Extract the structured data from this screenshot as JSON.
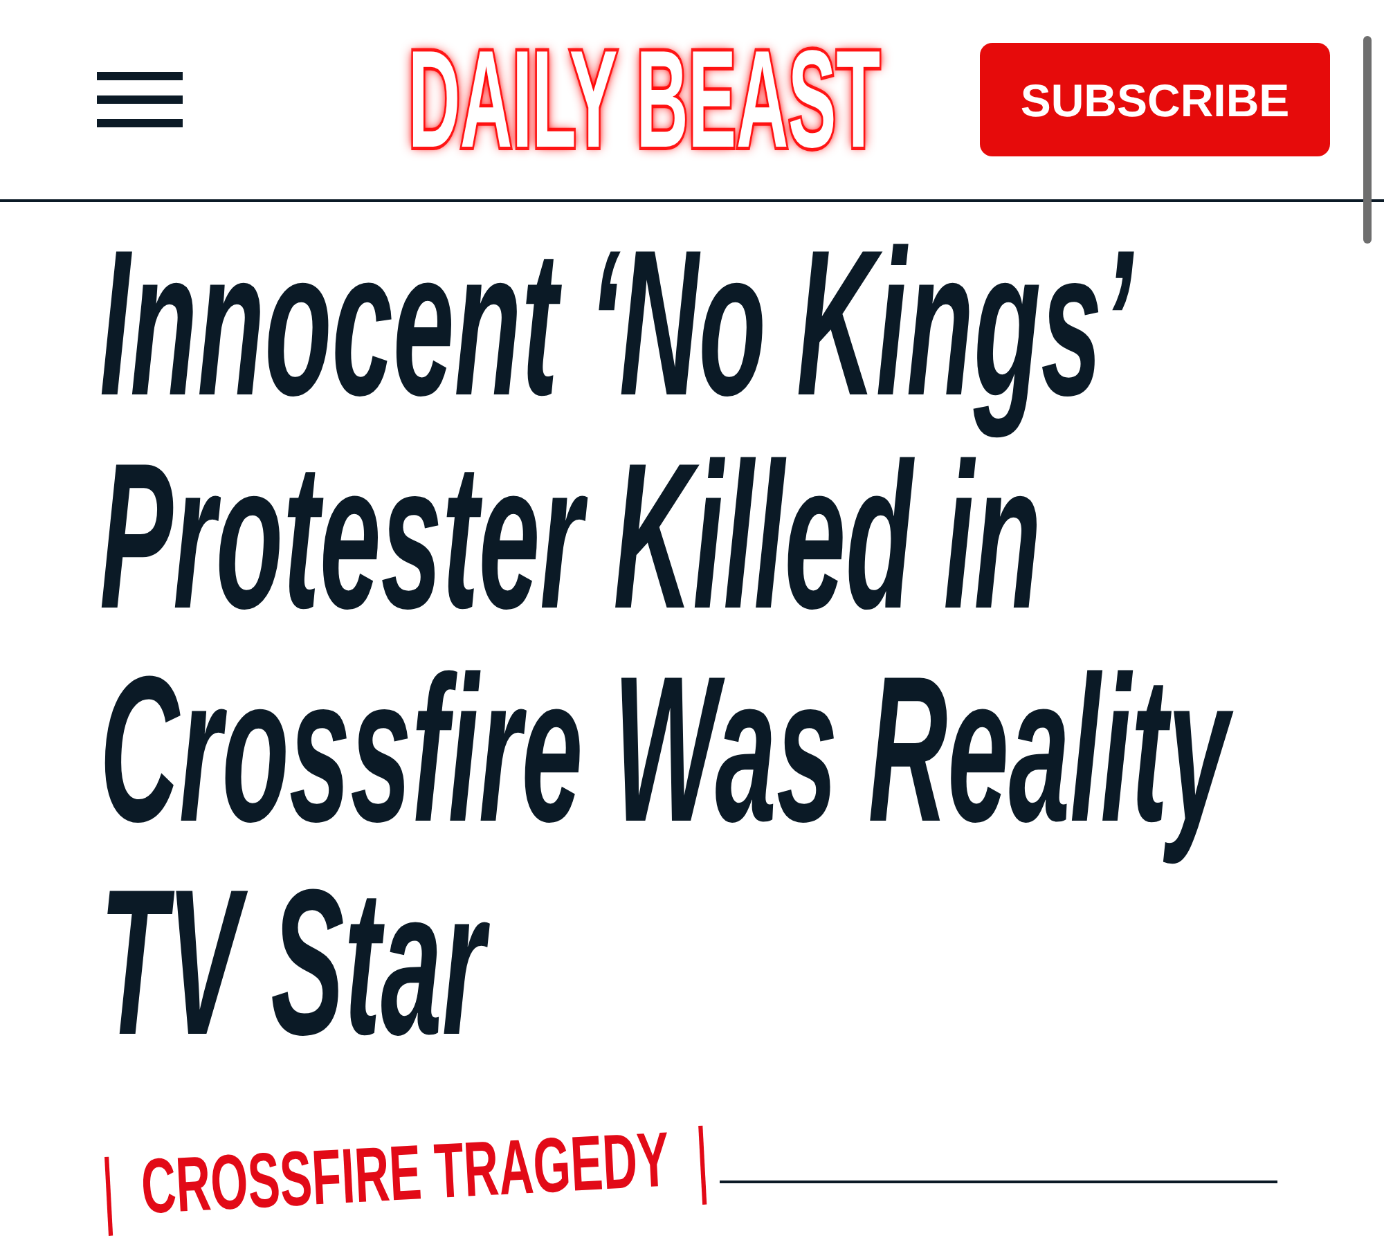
{
  "header": {
    "logo": "DAILY BEAST",
    "subscribe_button": "SUBSCRIBE"
  },
  "article": {
    "headline": "Innocent ‘No Kings’ Protester Killed in Crossfire Was Reality TV Star",
    "section_tag": "CROSSFIRE TRAGEDY"
  }
}
